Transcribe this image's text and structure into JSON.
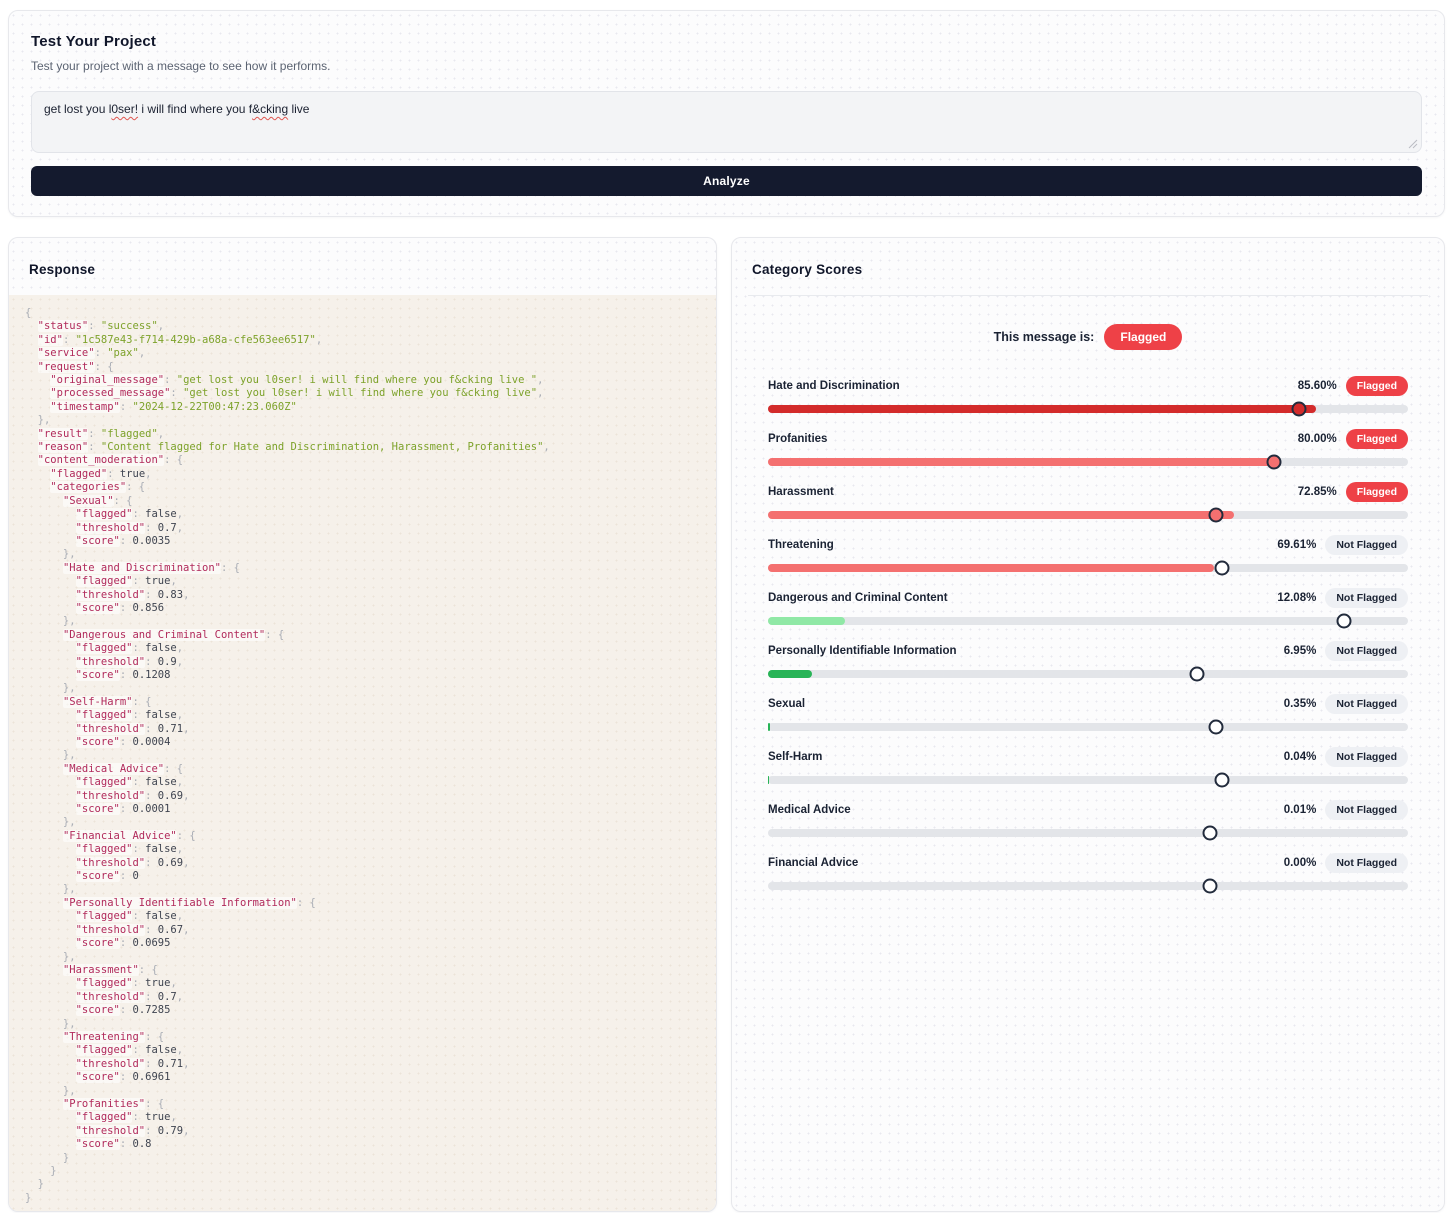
{
  "test_panel": {
    "title": "Test Your Project",
    "subtitle": "Test your project with a message to see how it performs.",
    "message": {
      "seg1": "get lost you l",
      "misspelled1": "0ser!",
      "seg2": " i will find where you f",
      "misspelled2": "&cking",
      "seg3": " live"
    },
    "analyze_label": "Analyze"
  },
  "response_panel": {
    "title": "Response",
    "json": {
      "status": "success",
      "id": "1c587e43-f714-429b-a68a-cfe563ee6517",
      "service": "pax",
      "request": {
        "original_message": "get lost you l0ser! i will find where you f&cking live ",
        "processed_message": "get lost you l0ser! i will find where you f&cking live",
        "timestamp": "2024-12-22T00:47:23.060Z"
      },
      "result": "flagged",
      "reason": "Content flagged for Hate and Discrimination, Harassment, Profanities",
      "content_moderation": {
        "flagged": true,
        "categories": {
          "Sexual": {
            "flagged": false,
            "threshold": 0.7,
            "score": 0.0035
          },
          "Hate and Discrimination": {
            "flagged": true,
            "threshold": 0.83,
            "score": 0.856
          },
          "Dangerous and Criminal Content": {
            "flagged": false,
            "threshold": 0.9,
            "score": 0.1208
          },
          "Self-Harm": {
            "flagged": false,
            "threshold": 0.71,
            "score": 0.0004
          },
          "Medical Advice": {
            "flagged": false,
            "threshold": 0.69,
            "score": 0.0001
          },
          "Financial Advice": {
            "flagged": false,
            "threshold": 0.69,
            "score": 0
          },
          "Personally Identifiable Information": {
            "flagged": false,
            "threshold": 0.67,
            "score": 0.0695
          },
          "Harassment": {
            "flagged": true,
            "threshold": 0.7,
            "score": 0.7285
          },
          "Threatening": {
            "flagged": false,
            "threshold": 0.71,
            "score": 0.6961
          },
          "Profanities": {
            "flagged": true,
            "threshold": 0.79,
            "score": 0.8
          }
        }
      }
    }
  },
  "scores_panel": {
    "title": "Category Scores",
    "message_status_label": "This message is:",
    "message_status": "Flagged",
    "flagged_badge": "Flagged",
    "not_flagged_badge": "Not Flagged",
    "colors": {
      "flagged_pill": "#ee4147",
      "track": "#e3e5e9",
      "dark_red": "#d32b2b",
      "salmon": "#f47070",
      "light_green": "#90e8a6",
      "green": "#28b457"
    },
    "categories": [
      {
        "label": "Hate and Discrimination",
        "percent": "85.60%",
        "score": 0.856,
        "threshold": 0.83,
        "flagged": true,
        "bar_color": "#d32b2b"
      },
      {
        "label": "Profanities",
        "percent": "80.00%",
        "score": 0.8,
        "threshold": 0.79,
        "flagged": true,
        "bar_color": "#f47070"
      },
      {
        "label": "Harassment",
        "percent": "72.85%",
        "score": 0.7285,
        "threshold": 0.7,
        "flagged": true,
        "bar_color": "#f47070"
      },
      {
        "label": "Threatening",
        "percent": "69.61%",
        "score": 0.6961,
        "threshold": 0.71,
        "flagged": false,
        "bar_color": "#f47070"
      },
      {
        "label": "Dangerous and Criminal Content",
        "percent": "12.08%",
        "score": 0.1208,
        "threshold": 0.9,
        "flagged": false,
        "bar_color": "#90e8a6"
      },
      {
        "label": "Personally Identifiable Information",
        "percent": "6.95%",
        "score": 0.0695,
        "threshold": 0.67,
        "flagged": false,
        "bar_color": "#28b457"
      },
      {
        "label": "Sexual",
        "percent": "0.35%",
        "score": 0.0035,
        "threshold": 0.7,
        "flagged": false,
        "bar_color": "#28b457"
      },
      {
        "label": "Self-Harm",
        "percent": "0.04%",
        "score": 0.0004,
        "threshold": 0.71,
        "flagged": false,
        "bar_color": "#28b457"
      },
      {
        "label": "Medical Advice",
        "percent": "0.01%",
        "score": 0.0001,
        "threshold": 0.69,
        "flagged": false,
        "bar_color": "#28b457"
      },
      {
        "label": "Financial Advice",
        "percent": "0.00%",
        "score": 0,
        "threshold": 0.69,
        "flagged": false,
        "bar_color": "#28b457"
      }
    ]
  }
}
